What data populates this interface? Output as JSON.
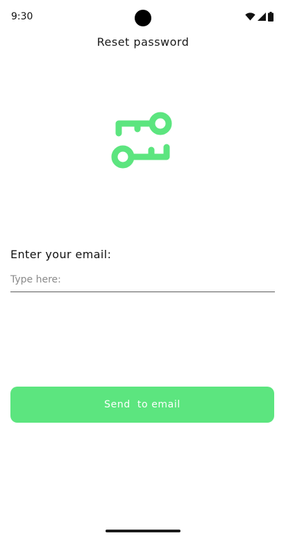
{
  "status_bar": {
    "time": "9:30",
    "icons": [
      "wifi-icon",
      "signal-icon",
      "battery-icon"
    ]
  },
  "header": {
    "title": "Reset password"
  },
  "hero": {
    "icon": "keys-icon",
    "color": "#5ce57f"
  },
  "form": {
    "email_label": "Enter your email:",
    "email_value": "",
    "email_placeholder": "Type here:"
  },
  "actions": {
    "send_label": "Send  to email",
    "send_color": "#5ce57f"
  }
}
